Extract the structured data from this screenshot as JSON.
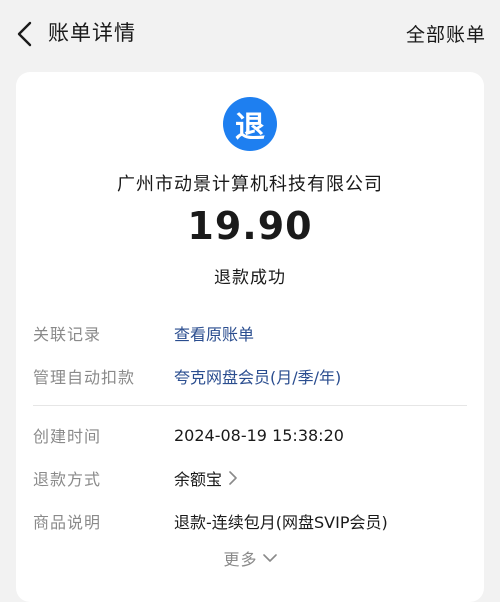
{
  "header": {
    "title": "账单详情",
    "right_link": "全部账单"
  },
  "summary": {
    "icon_char": "退",
    "merchant": "广州市动景计算机科技有限公司",
    "amount": "19.90",
    "status": "退款成功"
  },
  "details": [
    {
      "label": "关联记录",
      "value": "查看原账单"
    },
    {
      "label": "管理自动扣款",
      "value": "夸克网盘会员(月/季/年)"
    },
    {
      "label": "创建时间",
      "value": "2024-08-19 15:38:20"
    },
    {
      "label": "退款方式",
      "value": "余额宝"
    },
    {
      "label": "商品说明",
      "value": "退款-连续包月(网盘SVIP会员)"
    }
  ],
  "more_label": "更多",
  "colors": {
    "accent": "#1e7ff0",
    "link": "#2a4d8f",
    "label_gray": "#8a8a8a",
    "background": "#f2f2f2"
  }
}
